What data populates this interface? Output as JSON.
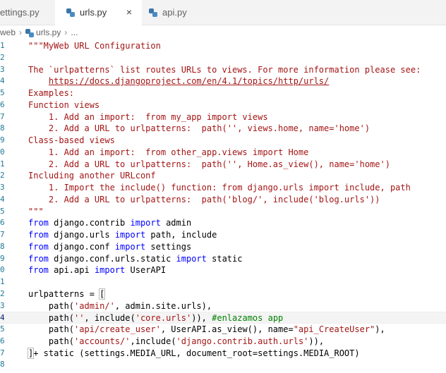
{
  "tabs": [
    {
      "label": "ettings.py"
    },
    {
      "label": "urls.py"
    },
    {
      "label": "api.py"
    }
  ],
  "tab_close_glyph": "×",
  "breadcrumb": {
    "folder": "web",
    "file": "urls.py",
    "more": "..."
  },
  "editor": {
    "lines": [
      {
        "n": "1",
        "tokens": [
          {
            "t": "\"\"\"MyWeb URL Configuration",
            "c": "s"
          }
        ]
      },
      {
        "n": "2",
        "tokens": []
      },
      {
        "n": "3",
        "tokens": [
          {
            "t": "The `urlpatterns` list routes URLs to views. For more information please see:",
            "c": "s"
          }
        ]
      },
      {
        "n": "4",
        "tokens": [
          {
            "t": "    ",
            "c": "s"
          },
          {
            "t": "https://docs.djangoproject.com/en/4.1/topics/http/urls/",
            "c": "lnk"
          }
        ]
      },
      {
        "n": "5",
        "tokens": [
          {
            "t": "Examples:",
            "c": "s"
          }
        ]
      },
      {
        "n": "6",
        "tokens": [
          {
            "t": "Function views",
            "c": "s"
          }
        ]
      },
      {
        "n": "7",
        "tokens": [
          {
            "t": "    1. Add an import:  from my_app import views",
            "c": "s"
          }
        ]
      },
      {
        "n": "8",
        "tokens": [
          {
            "t": "    2. Add a URL to urlpatterns:  path('', views.home, name='home')",
            "c": "s"
          }
        ]
      },
      {
        "n": "9",
        "tokens": [
          {
            "t": "Class-based views",
            "c": "s"
          }
        ]
      },
      {
        "n": "0",
        "tokens": [
          {
            "t": "    1. Add an import:  from other_app.views import Home",
            "c": "s"
          }
        ]
      },
      {
        "n": "1",
        "tokens": [
          {
            "t": "    2. Add a URL to urlpatterns:  path('', Home.as_view(), name='home')",
            "c": "s"
          }
        ]
      },
      {
        "n": "2",
        "tokens": [
          {
            "t": "Including another URLconf",
            "c": "s"
          }
        ]
      },
      {
        "n": "3",
        "tokens": [
          {
            "t": "    1. Import the include() function: from django.urls import include, path",
            "c": "s"
          }
        ]
      },
      {
        "n": "4",
        "tokens": [
          {
            "t": "    2. Add a URL to urlpatterns:  path('blog/', include('blog.urls'))",
            "c": "s"
          }
        ]
      },
      {
        "n": "5",
        "tokens": [
          {
            "t": "\"\"\"",
            "c": "s"
          }
        ]
      },
      {
        "n": "6",
        "tokens": [
          {
            "t": "from",
            "c": "kw"
          },
          {
            "t": " django.contrib ",
            "c": "pl"
          },
          {
            "t": "import",
            "c": "kw"
          },
          {
            "t": " admin",
            "c": "pl"
          }
        ]
      },
      {
        "n": "7",
        "tokens": [
          {
            "t": "from",
            "c": "kw"
          },
          {
            "t": " django.urls ",
            "c": "pl"
          },
          {
            "t": "import",
            "c": "kw"
          },
          {
            "t": " path, include",
            "c": "pl"
          }
        ]
      },
      {
        "n": "8",
        "tokens": [
          {
            "t": "from",
            "c": "kw"
          },
          {
            "t": " django.conf ",
            "c": "pl"
          },
          {
            "t": "import",
            "c": "kw"
          },
          {
            "t": " settings",
            "c": "pl"
          }
        ]
      },
      {
        "n": "9",
        "tokens": [
          {
            "t": "from",
            "c": "kw"
          },
          {
            "t": " django.conf.urls.static ",
            "c": "pl"
          },
          {
            "t": "import",
            "c": "kw"
          },
          {
            "t": " static",
            "c": "pl"
          }
        ]
      },
      {
        "n": "0",
        "tokens": [
          {
            "t": "from",
            "c": "kw"
          },
          {
            "t": " api.api ",
            "c": "pl"
          },
          {
            "t": "import",
            "c": "kw"
          },
          {
            "t": " UserAPI",
            "c": "pl"
          }
        ]
      },
      {
        "n": "1",
        "tokens": []
      },
      {
        "n": "2",
        "tokens": [
          {
            "t": "urlpatterns = ",
            "c": "pl"
          },
          {
            "t": "[",
            "c": "pl",
            "box": true
          }
        ]
      },
      {
        "n": "3",
        "tokens": [
          {
            "t": "    path(",
            "c": "pl"
          },
          {
            "t": "'admin/'",
            "c": "s"
          },
          {
            "t": ", admin.site.urls),",
            "c": "pl"
          }
        ]
      },
      {
        "n": "4",
        "current": true,
        "tokens": [
          {
            "t": "    path(",
            "c": "pl"
          },
          {
            "t": "''",
            "c": "s"
          },
          {
            "t": ", include(",
            "c": "pl"
          },
          {
            "t": "'core.urls'",
            "c": "s"
          },
          {
            "t": ")), ",
            "c": "pl"
          },
          {
            "t": "#enlazamos app",
            "c": "cm"
          }
        ]
      },
      {
        "n": "5",
        "tokens": [
          {
            "t": "    path(",
            "c": "pl"
          },
          {
            "t": "'api/create_user'",
            "c": "s"
          },
          {
            "t": ", UserAPI.as_view(), name=",
            "c": "pl"
          },
          {
            "t": "\"api_CreateUser\"",
            "c": "s"
          },
          {
            "t": "),",
            "c": "pl"
          }
        ]
      },
      {
        "n": "6",
        "tokens": [
          {
            "t": "    path(",
            "c": "pl"
          },
          {
            "t": "'accounts/'",
            "c": "s"
          },
          {
            "t": ",include(",
            "c": "pl"
          },
          {
            "t": "'django.contrib.auth.urls'",
            "c": "s"
          },
          {
            "t": ")),",
            "c": "pl"
          }
        ]
      },
      {
        "n": "7",
        "tokens": [
          {
            "t": "]",
            "c": "pl",
            "box": true
          },
          {
            "t": "+ static (settings.MEDIA_URL, document_root=settings.MEDIA_ROOT)",
            "c": "pl"
          }
        ]
      },
      {
        "n": "8",
        "tokens": []
      }
    ]
  },
  "colors": {
    "string": "#a31515",
    "keyword": "#0000ff",
    "comment": "#008000",
    "line_number": "#237893",
    "text": "#000000"
  }
}
